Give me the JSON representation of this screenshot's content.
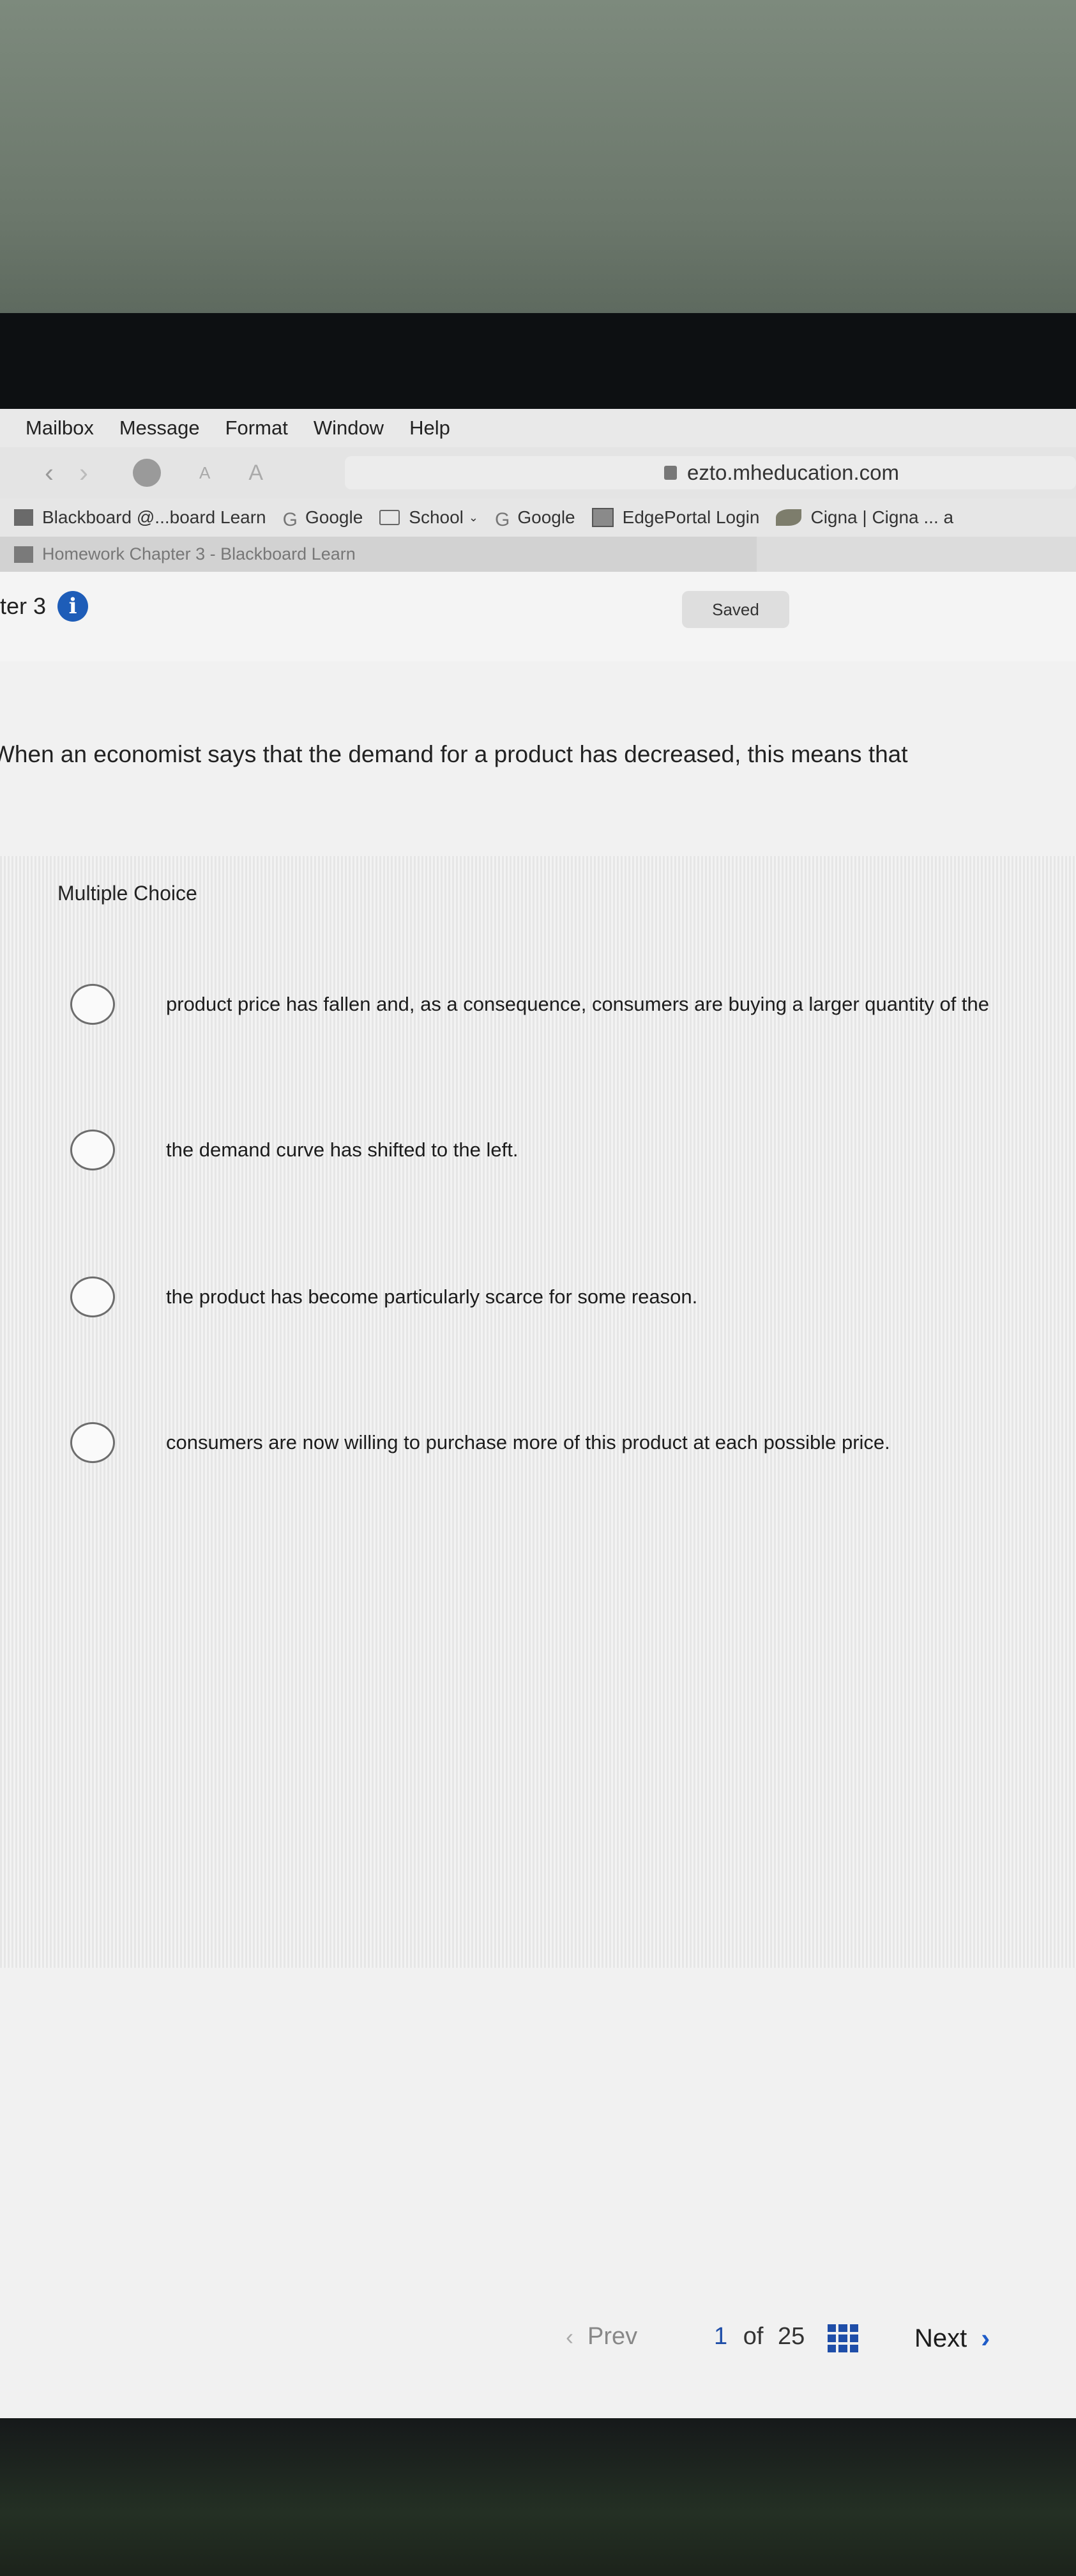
{
  "menubar": {
    "items": [
      "Mailbox",
      "Message",
      "Format",
      "Window",
      "Help"
    ]
  },
  "address": {
    "url": "ezto.mheducation.com",
    "text_size_small": "A",
    "text_size_large": "A"
  },
  "bookmarks": [
    {
      "label": "Blackboard @...board Learn",
      "icon": "blackboard-icon"
    },
    {
      "label": "Google",
      "icon": "google-icon"
    },
    {
      "label": "School",
      "icon": "folder-icon"
    },
    {
      "label": "Google",
      "icon": "google-icon"
    },
    {
      "label": "EdgePortal Login",
      "icon": "edgeportal-icon"
    },
    {
      "label": "Cigna | Cigna ... a",
      "icon": "cigna-icon"
    }
  ],
  "tab": {
    "title": "Homework Chapter 3 - Blackboard Learn"
  },
  "header": {
    "chapter": "ter 3",
    "saved": "Saved"
  },
  "question": {
    "text": "When an economist says that the demand for a product has decreased, this means that"
  },
  "choices": {
    "label": "Multiple Choice",
    "options": [
      "product price has fallen and, as a consequence, consumers are buying a larger quantity of the",
      "the demand curve has shifted to the left.",
      "the product has become particularly scarce for some reason.",
      "consumers are now willing to purchase more of this product at each possible price."
    ]
  },
  "footer": {
    "prev": "Prev",
    "page_current": "1",
    "page_of": "of",
    "page_total": "25",
    "next": "Next"
  },
  "colors": {
    "accent": "#1f4ea8",
    "info": "#1e5db8"
  }
}
